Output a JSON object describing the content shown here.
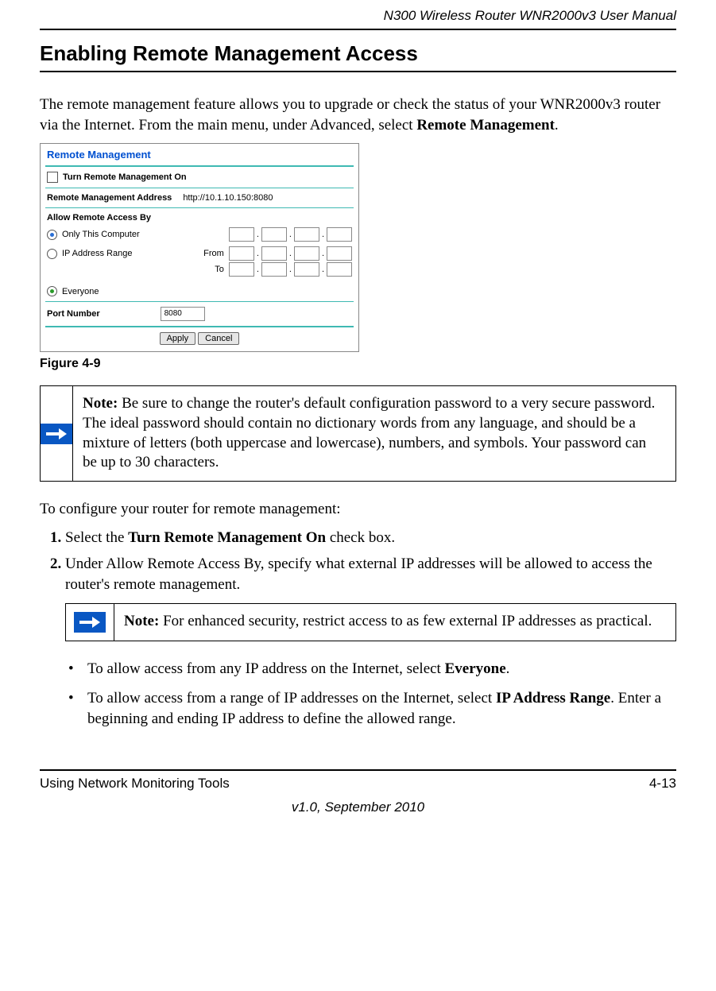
{
  "header": {
    "manual_title": "N300 Wireless Router WNR2000v3 User Manual"
  },
  "title": "Enabling Remote Management Access",
  "intro": {
    "part1": "The remote management feature allows you to upgrade or check the status of your WNR2000v3 router via the Internet. From the main menu, under Advanced, select ",
    "bold": "Remote Management",
    "part3": "."
  },
  "screenshot": {
    "title": "Remote Management",
    "toggle_label": "Turn Remote Management On",
    "address_label": "Remote Management Address",
    "address_value": "http://10.1.10.150:8080",
    "allow_label": "Allow Remote Access By",
    "opt_only": "Only This Computer",
    "opt_range": "IP Address Range",
    "from_label": "From",
    "to_label": "To",
    "opt_everyone": "Everyone",
    "port_label": "Port Number",
    "port_value": "8080",
    "btn_apply": "Apply",
    "btn_cancel": "Cancel"
  },
  "figure_caption": "Figure 4-9",
  "note1": {
    "prefix": "Note:",
    "text": " Be sure to change the router's default configuration password to a very secure password. The ideal password should contain no dictionary words from any language, and should be a mixture of letters (both uppercase and lowercase), numbers, and symbols. Your password can be up to 30 characters."
  },
  "config_intro": "To configure your router for remote management:",
  "steps": {
    "s1a": "Select the ",
    "s1b": "Turn Remote Management On",
    "s1c": " check box.",
    "s2": "Under Allow Remote Access By, specify what external IP addresses will be allowed to access the router's remote management."
  },
  "note2": {
    "prefix": "Note:",
    "text": " For enhanced security, restrict access to as few external IP addresses as practical."
  },
  "bullets": {
    "b1a": "To allow access from any IP address on the Internet, select ",
    "b1b": "Everyone",
    "b1c": ".",
    "b2a": "To allow access from a range of IP addresses on the Internet, select ",
    "b2b": "IP Address Range",
    "b2c": ". Enter a beginning and ending IP address to define the allowed range."
  },
  "footer": {
    "left": "Using Network Monitoring Tools",
    "right": "4-13",
    "center": "v1.0, September 2010"
  }
}
